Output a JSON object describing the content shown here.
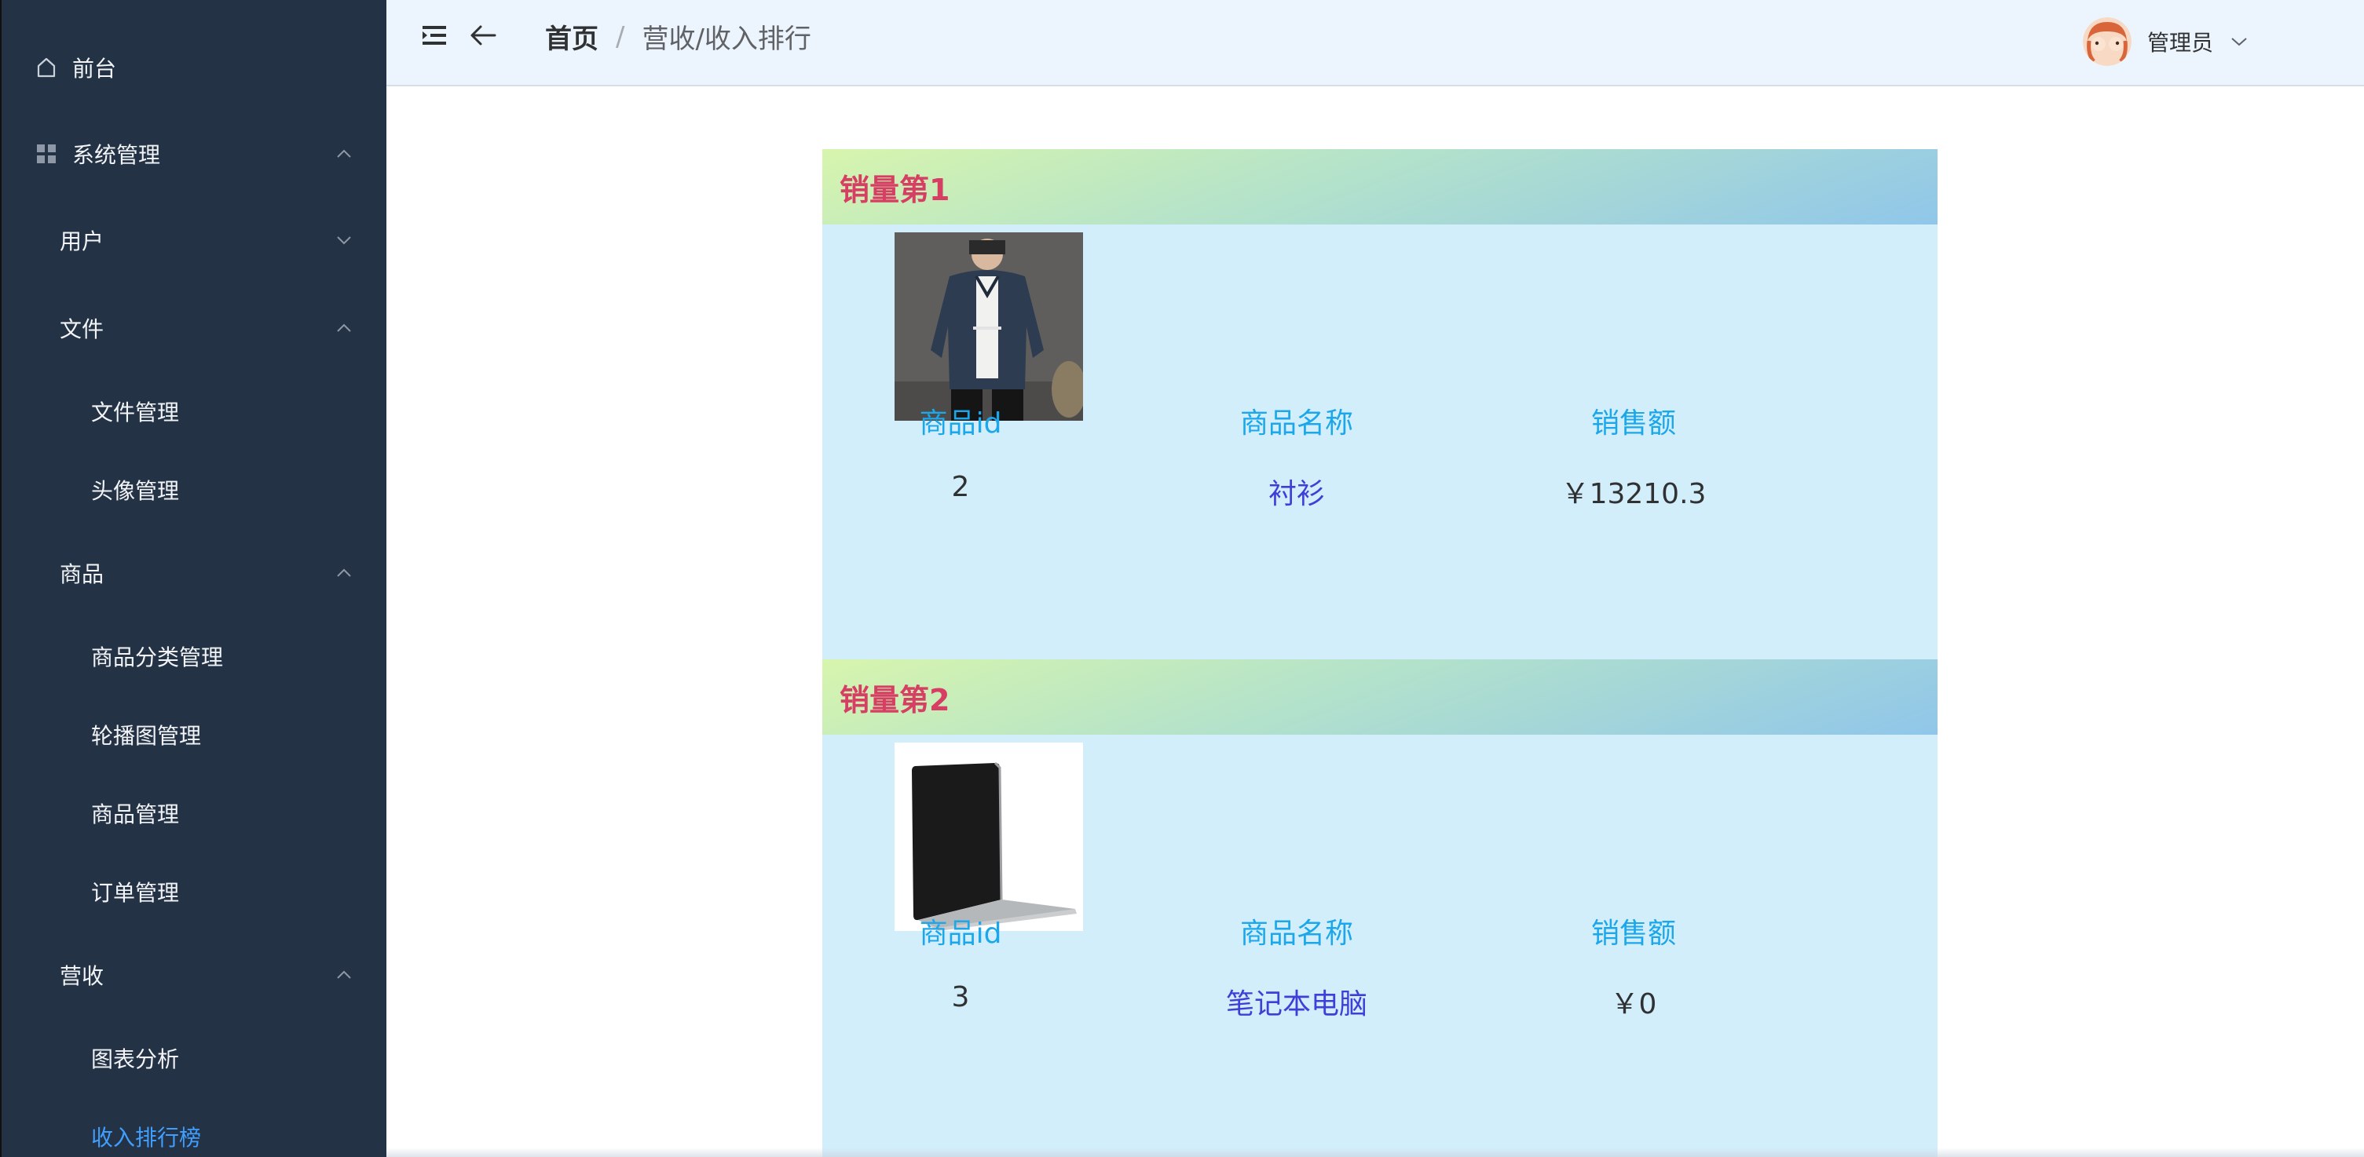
{
  "sidebar": {
    "items": [
      {
        "label": "前台",
        "icon": "home-icon",
        "level": 0
      },
      {
        "label": "系统管理",
        "icon": "grid-icon",
        "level": 0,
        "expanded": true
      },
      {
        "label": "用户",
        "level": 1,
        "expanded": false
      },
      {
        "label": "文件",
        "level": 1,
        "expanded": true
      },
      {
        "label": "文件管理",
        "level": 2
      },
      {
        "label": "头像管理",
        "level": 2
      },
      {
        "label": "商品",
        "level": 1,
        "expanded": true
      },
      {
        "label": "商品分类管理",
        "level": 2
      },
      {
        "label": "轮播图管理",
        "level": 2
      },
      {
        "label": "商品管理",
        "level": 2
      },
      {
        "label": "订单管理",
        "level": 2
      },
      {
        "label": "营收",
        "level": 1,
        "expanded": true
      },
      {
        "label": "图表分析",
        "level": 2
      },
      {
        "label": "收入排行榜",
        "level": 2,
        "active": true
      }
    ]
  },
  "header": {
    "menu_toggle_icon": "menu-fold-icon",
    "back_icon": "arrow-left-icon",
    "breadcrumb": {
      "home": "首页",
      "separator": "/",
      "current": "营收/收入排行"
    },
    "user": {
      "name": "管理员",
      "avatar_icon": "avatar-icon"
    }
  },
  "ranking": {
    "columns": {
      "id": "商品id",
      "name": "商品名称",
      "sales": "销售额"
    },
    "cards": [
      {
        "title": "销量第1",
        "image": "shirt-image",
        "id": "2",
        "name": "衬衫",
        "sales": "￥13210.3"
      },
      {
        "title": "销量第2",
        "image": "laptop-image",
        "id": "3",
        "name": "笔记本电脑",
        "sales": "￥0"
      }
    ]
  },
  "colors": {
    "sidebar_bg": "#243245",
    "header_bg": "#ecf5fd",
    "card_bg": "#d3eefb",
    "rank_title": "#d73e63",
    "column_header": "#1ba7ea",
    "product_name": "#3f3fd8",
    "active_menu": "#409eff"
  }
}
